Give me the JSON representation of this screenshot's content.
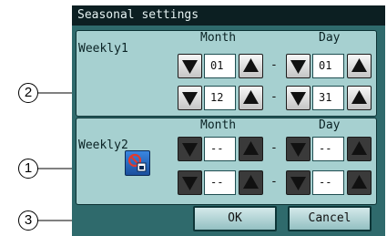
{
  "window": {
    "title": "Seasonal settings"
  },
  "weekly1": {
    "label": "Weekly1",
    "month_header": "Month",
    "day_header": "Day",
    "start": {
      "month": "01",
      "day": "01"
    },
    "end": {
      "month": "12",
      "day": "31"
    }
  },
  "weekly2": {
    "label": "Weekly2",
    "month_header": "Month",
    "day_header": "Day",
    "start": {
      "month": "--",
      "day": "--"
    },
    "end": {
      "month": "--",
      "day": "--"
    }
  },
  "separator": "-",
  "footer": {
    "ok_label": "OK",
    "cancel_label": "Cancel"
  },
  "callouts": {
    "c1": "1",
    "c2": "2",
    "c3": "3"
  },
  "icons": {
    "down": "triangle-down-icon",
    "up": "triangle-up-icon",
    "copy": "copy-icon"
  },
  "colors": {
    "screen_bg": "#2f6a6c",
    "panel_bg": "#a6d0d0",
    "titlebar_bg": "#0c1f22"
  }
}
